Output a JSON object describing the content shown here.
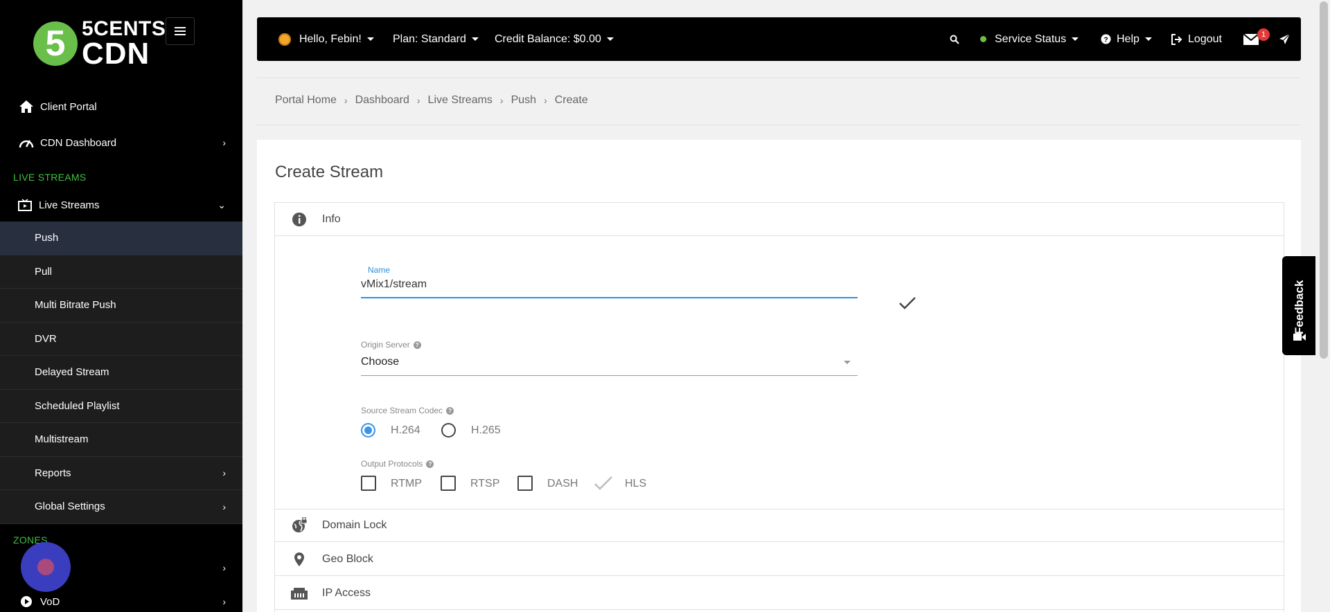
{
  "brand": {
    "logo_digit": "5",
    "line1": "5CENTS",
    "line2": "CDN"
  },
  "sidebar": {
    "client_portal": "Client Portal",
    "cdn_dashboard": "CDN Dashboard",
    "section_live": "LIVE STREAMS",
    "live_streams": "Live Streams",
    "sub_items": {
      "push": "Push",
      "pull": "Pull",
      "multi_bitrate": "Multi Bitrate Push",
      "dvr": "DVR",
      "delayed": "Delayed Stream",
      "scheduled": "Scheduled Playlist",
      "multistream": "Multistream",
      "reports": "Reports",
      "global_settings": "Global Settings"
    },
    "section_zones": "ZONES",
    "vod": "VoD"
  },
  "topbar": {
    "greeting": "Hello, Febin!",
    "plan": "Plan: Standard",
    "credit": "Credit Balance: $0.00",
    "service_status": "Service Status",
    "help": "Help",
    "logout": "Logout",
    "messages_badge": "1"
  },
  "breadcrumb": [
    "Portal Home",
    "Dashboard",
    "Live Streams",
    "Push",
    "Create"
  ],
  "main": {
    "title": "Create Stream",
    "sections": {
      "info": "Info",
      "domain_lock": "Domain Lock",
      "geo_block": "Geo Block",
      "ip_access": "IP Access"
    },
    "form": {
      "name_label": "Name",
      "name_value": "vMix1/stream",
      "origin_label": "Origin Server",
      "origin_value": "Choose",
      "codec_label": "Source Stream Codec",
      "codec_options": [
        "H.264",
        "H.265"
      ],
      "codec_selected": "H.264",
      "protocols_label": "Output Protocols",
      "protocols": [
        "RTMP",
        "RTSP",
        "DASH",
        "HLS"
      ]
    }
  },
  "feedback": "Feedback",
  "colors": {
    "accent_blue": "#2f8fdb",
    "brand_green": "#6abf4b",
    "section_green": "#3fc23f",
    "badge_red": "#e53935"
  }
}
